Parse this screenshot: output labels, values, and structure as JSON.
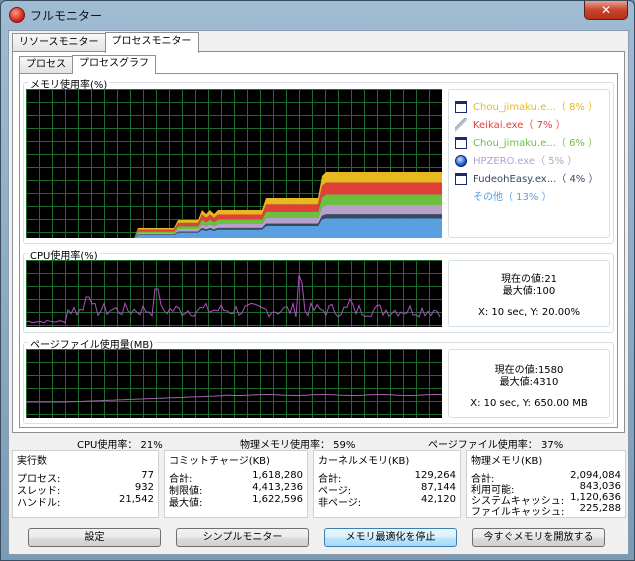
{
  "window": {
    "title": "フルモニター",
    "close_glyph": "✕"
  },
  "tabs_outer": [
    "リソースモニター",
    "プロセスモニター"
  ],
  "tabs_inner": [
    "プロセス",
    "プロセスグラフ"
  ],
  "memory_graph": {
    "label": "メモリ使用率(%)",
    "legend": [
      {
        "name": "Chou_jimaku.e...",
        "pct": "（ 8% ）",
        "color": "#e8b820",
        "icon": "window-icon"
      },
      {
        "name": "Keikai.exe",
        "pct": "（ 7% ）",
        "color": "#e0403a",
        "icon": "pen-icon"
      },
      {
        "name": "Chou_jimaku.e...",
        "pct": "（ 6% ）",
        "color": "#6cc040",
        "icon": "window-icon"
      },
      {
        "name": "HPZERO.exe",
        "pct": "（ 5% ）",
        "color": "#b8a0cc",
        "icon": "drop-icon"
      },
      {
        "name": "FudeohEasy.ex...",
        "pct": "（ 4% ）",
        "color": "#384860",
        "icon": "window-icon"
      },
      {
        "name": "その他",
        "pct": "（ 13% ）",
        "color": "#5aa0e0",
        "icon": "none"
      }
    ],
    "colors": {
      "grid": "#1e6b2e"
    }
  },
  "cpu_graph": {
    "label": "CPU使用率(%)",
    "current": "現在の値:21",
    "max": "最大値:100",
    "coords": "X: 10 sec,  Y: 20.00%",
    "line_color": "#b050c0"
  },
  "page_graph": {
    "label": "ページファイル使用量(MB)",
    "current": "現在の値:1580",
    "max": "最大値:4310",
    "coords": "X: 10 sec,  Y: 650.00 MB",
    "line_color": "#9a6aa8"
  },
  "status": {
    "cpu": "CPU使用率： 21%",
    "phys": "物理メモリ使用率： 59%",
    "page": "ページファイル使用率： 37%"
  },
  "stats": {
    "exec": {
      "title": "実行数",
      "rows": [
        [
          "プロセス:",
          "77"
        ],
        [
          "スレッド:",
          "932"
        ],
        [
          "ハンドル:",
          "21,542"
        ]
      ]
    },
    "commit": {
      "title": "コミットチャージ(KB)",
      "rows": [
        [
          "合計:",
          "1,618,280"
        ],
        [
          "制限値:",
          "4,413,236"
        ],
        [
          "最大値:",
          "1,622,596"
        ]
      ]
    },
    "kernel": {
      "title": "カーネルメモリ(KB)",
      "rows": [
        [
          "合計:",
          "129,264"
        ],
        [
          "ページ:",
          "87,144"
        ],
        [
          "非ページ:",
          "42,120"
        ]
      ]
    },
    "physical": {
      "title": "物理メモリ(KB)",
      "rows": [
        [
          "合計:",
          "2,094,084"
        ],
        [
          "利用可能:",
          "843,036"
        ],
        [
          "システムキャッシュ:",
          "1,120,636"
        ],
        [
          "ファイルキャッシュ:",
          "225,288"
        ]
      ]
    }
  },
  "buttons": {
    "settings": "設定",
    "simple": "シンプルモニター",
    "stop_opt": "メモリ最適化を停止",
    "free_now": "今すぐメモリを開放する"
  }
}
